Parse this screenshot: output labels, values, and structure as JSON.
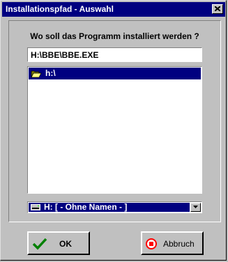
{
  "window": {
    "title": "Installationspfad - Auswahl",
    "close_glyph": "x-icon"
  },
  "prompt": {
    "question": "Wo soll das Programm installiert werden ?"
  },
  "path_input": {
    "value": "H:\\BBE\\BBE.EXE"
  },
  "directory_list": {
    "items": [
      {
        "label": "h:\\",
        "icon": "open-folder-icon",
        "selected": true
      }
    ]
  },
  "drive_select": {
    "selected": "H: [ - Ohne Namen - ]",
    "icon": "drive-icon"
  },
  "buttons": {
    "ok_label": "OK",
    "ok_icon": "checkmark-icon",
    "cancel_label": "Abbruch",
    "cancel_icon": "stop-icon"
  },
  "colors": {
    "face": "#c0c0c0",
    "titlebar": "#000080",
    "selection": "#000080",
    "checkmark": "#008000",
    "stop": "#ff0000"
  }
}
